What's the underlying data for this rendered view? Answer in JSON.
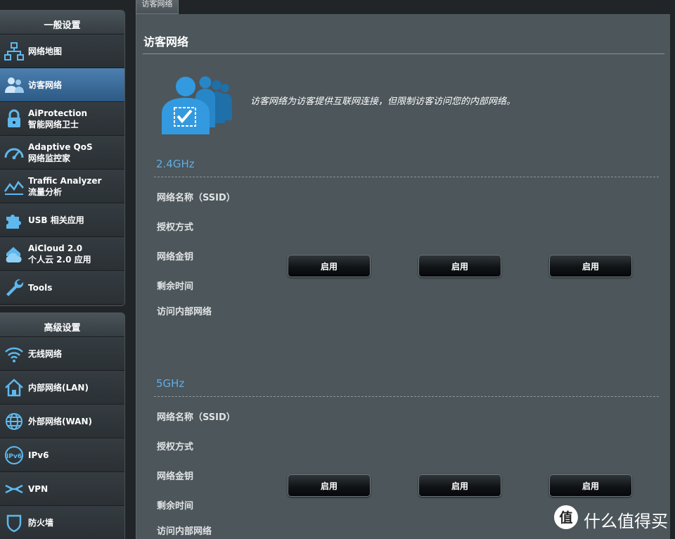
{
  "top_tab": {
    "label": "访客网络"
  },
  "sidebar": {
    "general_title": "一般设置",
    "general_items": [
      {
        "line1": "网络地图",
        "line2": "",
        "icon": "network-map-icon"
      },
      {
        "line1": "访客网络",
        "line2": "",
        "icon": "guest-network-icon",
        "active": true
      },
      {
        "line1": "AiProtection",
        "line2": "智能网络卫士",
        "icon": "lock-icon"
      },
      {
        "line1": "Adaptive QoS",
        "line2": "网络监控家",
        "icon": "speedometer-icon"
      },
      {
        "line1": "Traffic Analyzer",
        "line2": "流量分析",
        "icon": "traffic-chart-icon"
      },
      {
        "line1": "USB 相关应用",
        "line2": "",
        "icon": "puzzle-icon"
      },
      {
        "line1": "AiCloud 2.0",
        "line2": "个人云 2.0 应用",
        "icon": "cloud-home-icon"
      },
      {
        "line1": "Tools",
        "line2": "",
        "icon": "wrench-icon"
      }
    ],
    "advanced_title": "高级设置",
    "advanced_items": [
      {
        "line1": "无线网络",
        "icon": "wifi-icon"
      },
      {
        "line1": "内部网络(LAN)",
        "icon": "home-icon"
      },
      {
        "line1": "外部网络(WAN)",
        "icon": "globe-icon"
      },
      {
        "line1": "IPv6",
        "icon": "ipv6-icon"
      },
      {
        "line1": "VPN",
        "icon": "vpn-icon"
      },
      {
        "line1": "防火墙",
        "icon": "shield-icon"
      }
    ]
  },
  "main": {
    "title": "访客网络",
    "description": "访客网络为访客提供互联网连接，但限制访客访问您的内部网络。",
    "bands": [
      {
        "name": "2.4GHz",
        "labels": [
          "网络名称（SSID）",
          "授权方式",
          "网络金钥",
          "剩余时间",
          "访问内部网络"
        ],
        "buttons": [
          "启用",
          "启用",
          "启用"
        ]
      },
      {
        "name": "5GHz",
        "labels": [
          "网络名称（SSID）",
          "授权方式",
          "网络金钥",
          "剩余时间",
          "访问内部网络"
        ],
        "buttons": [
          "启用",
          "启用",
          "启用"
        ]
      }
    ]
  },
  "watermark": {
    "text": "什么值得买",
    "logo_char": "值"
  },
  "colors": {
    "accent_blue": "#5eaee6",
    "active_item": "#3d6f9f",
    "panel": "#4c565b"
  }
}
